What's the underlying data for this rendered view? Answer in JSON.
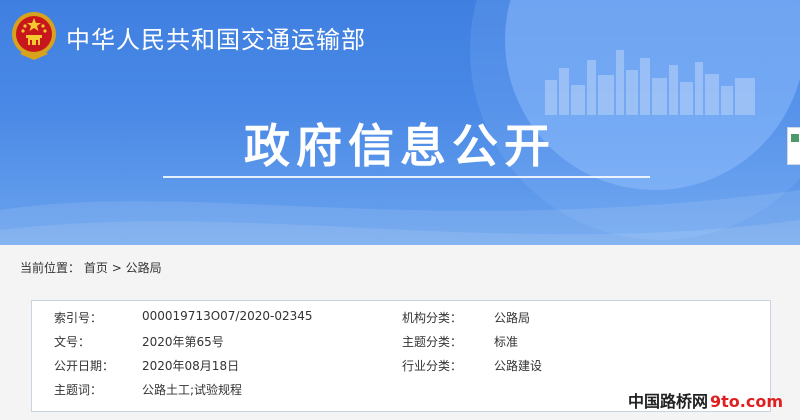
{
  "header": {
    "ministry_name": "中华人民共和国交通运输部",
    "page_title": "政府信息公开"
  },
  "breadcrumb": {
    "prefix": "当前位置：",
    "home": "首页",
    "separator": ">",
    "current": "公路局"
  },
  "info": {
    "index_label": "索引号：",
    "index_value": "000019713O07/2020-02345",
    "org_label": "机构分类：",
    "org_value": "公路局",
    "doc_no_label": "文号：",
    "doc_no_value": "2020年第65号",
    "topic_label": "主题分类：",
    "topic_value": "标准",
    "date_label": "公开日期：",
    "date_value": "2020年08月18日",
    "industry_label": "行业分类：",
    "industry_value": "公路建设",
    "keyword_label": "主题词：",
    "keyword_value": "公路土工;试验规程"
  },
  "watermark": {
    "site_name": "中国路桥网",
    "domain": "9to.com"
  },
  "icons": {
    "emblem": "national-emblem-icon",
    "skyline": "city-skyline-decoration"
  },
  "colors": {
    "banner_blue": "#4a89e6",
    "watermark_red": "#e02020"
  }
}
